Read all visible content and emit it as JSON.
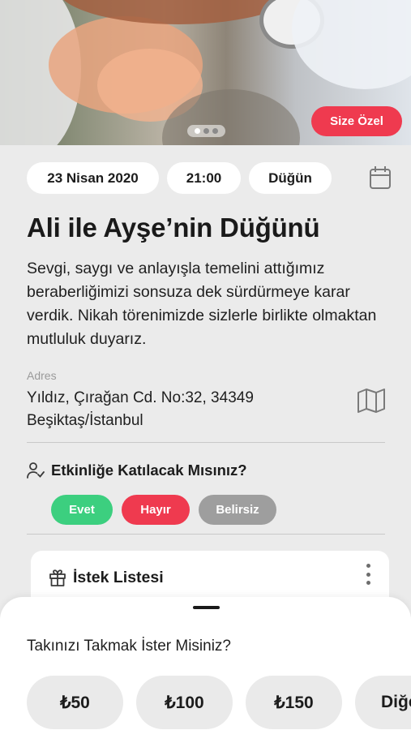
{
  "hero": {
    "badge": "Size Özel",
    "carousel": {
      "total": 3,
      "active": 1
    }
  },
  "event": {
    "date": "23 Nisan 2020",
    "time": "21:00",
    "type": "Düğün",
    "title": "Ali ile Ayşe’nin Düğünü",
    "description": "Sevgi, saygı ve anlayışla temelini attığımız beraberliğimizi sonsuza dek sürdürmeye karar verdik. Nikah törenimizde sizlerle birlikte olmaktan mutluluk duyarız.",
    "address_label": "Adres",
    "address_line1": "Yıldız, Çırağan Cd. No:32, 34349",
    "address_line2": "Beşiktaş/İstanbul"
  },
  "rsvp": {
    "question": "Etkinliğe Katılacak Mısınız?",
    "yes": "Evet",
    "no": "Hayır",
    "maybe": "Belirsiz"
  },
  "wishlist": {
    "title": "İstek Listesi"
  },
  "sheet": {
    "title": "Takınızı Takmak İster Misiniz?",
    "amounts": [
      "₺50",
      "₺100",
      "₺150",
      "Diğer"
    ]
  },
  "colors": {
    "accent_red": "#ef3a4f",
    "yes_green": "#3ccf7f",
    "maybe_gray": "#9e9e9e"
  },
  "icons": [
    "calendar-icon",
    "map-icon",
    "user-check-icon",
    "gift-icon",
    "more-vertical-icon"
  ]
}
